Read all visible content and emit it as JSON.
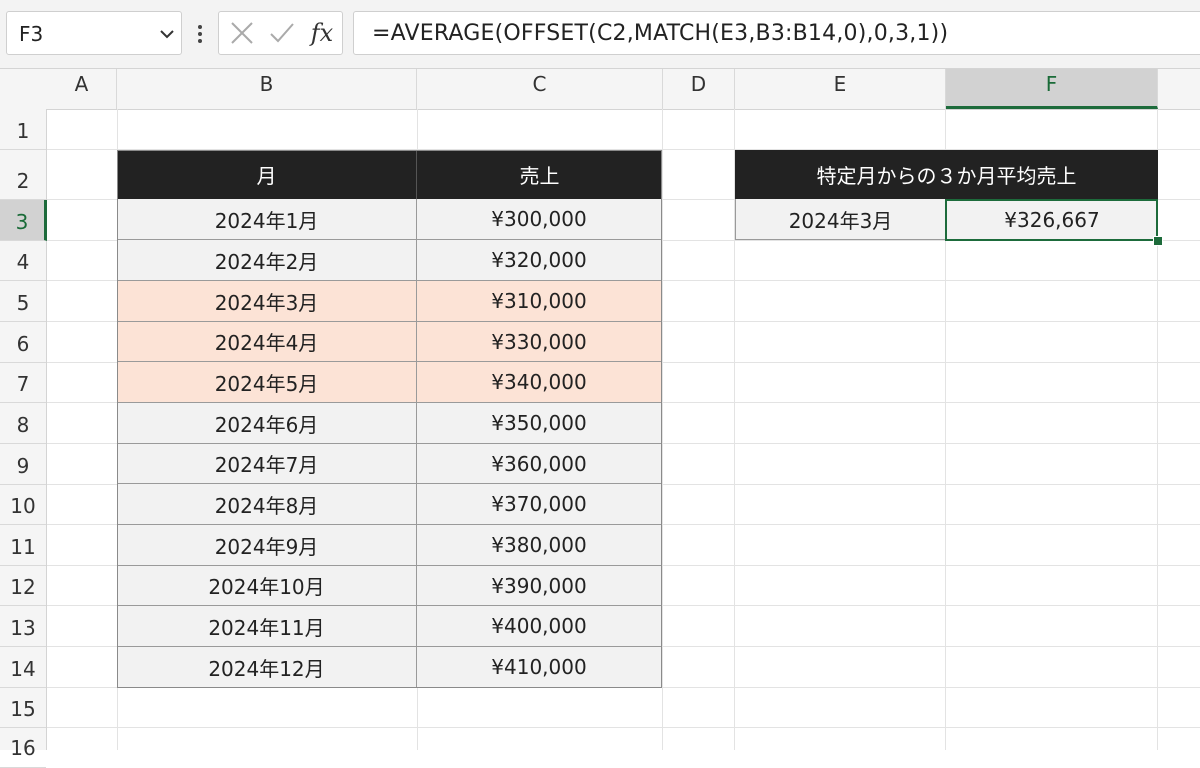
{
  "name_box": {
    "value": "F3"
  },
  "formula_bar": {
    "text": "=AVERAGE(OFFSET(C2,MATCH(E3,B3:B14,0),0,3,1))"
  },
  "icons": {
    "cancel": "x-icon",
    "enter": "check-icon",
    "function": "fx-icon",
    "more": "vertical-dots-icon",
    "dropdown": "chevron-down-icon"
  },
  "fx_label": "fx",
  "columns": [
    "A",
    "B",
    "C",
    "D",
    "E",
    "F"
  ],
  "selected_column": "F",
  "rows": [
    "1",
    "2",
    "3",
    "4",
    "5",
    "6",
    "7",
    "8",
    "9",
    "10",
    "11",
    "12",
    "13",
    "14",
    "15",
    "16"
  ],
  "selected_row": "3",
  "table": {
    "headers": [
      "月",
      "売上"
    ],
    "rows": [
      {
        "month": "2024年1月",
        "sales": "¥300,000"
      },
      {
        "month": "2024年2月",
        "sales": "¥320,000"
      },
      {
        "month": "2024年3月",
        "sales": "¥310,000"
      },
      {
        "month": "2024年4月",
        "sales": "¥330,000"
      },
      {
        "month": "2024年5月",
        "sales": "¥340,000"
      },
      {
        "month": "2024年6月",
        "sales": "¥350,000"
      },
      {
        "month": "2024年7月",
        "sales": "¥360,000"
      },
      {
        "month": "2024年8月",
        "sales": "¥370,000"
      },
      {
        "month": "2024年9月",
        "sales": "¥380,000"
      },
      {
        "month": "2024年10月",
        "sales": "¥390,000"
      },
      {
        "month": "2024年11月",
        "sales": "¥400,000"
      },
      {
        "month": "2024年12月",
        "sales": "¥410,000"
      }
    ]
  },
  "highlighted_rows": [
    3,
    4,
    5
  ],
  "summary": {
    "header": "特定月からの３か月平均売上",
    "month": "2024年3月",
    "result": "¥326,667"
  },
  "colors": {
    "header_bg": "#222222",
    "data_bg": "#f2f2f2",
    "highlight_bg": "#fce3d6",
    "selection": "#1d6b3b"
  }
}
